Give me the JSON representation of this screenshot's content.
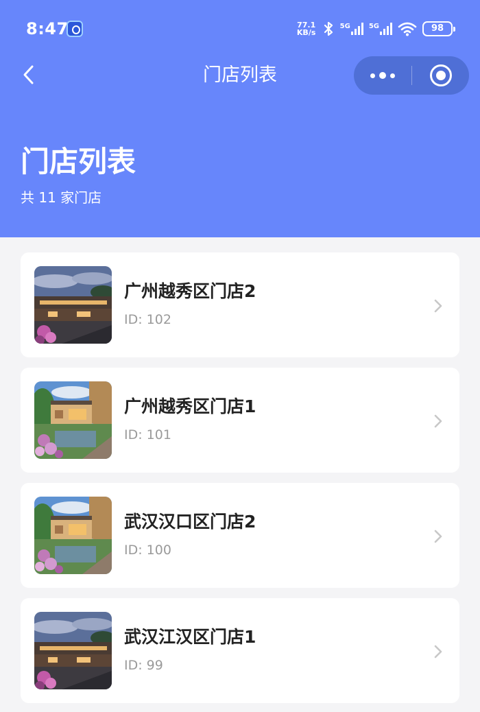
{
  "status_bar": {
    "time": "8:47",
    "net_speed_value": "77.1",
    "net_speed_unit": "KB/s",
    "signal_1_label": "5G",
    "signal_2_label": "5G",
    "battery": "98"
  },
  "nav": {
    "title": "门店列表"
  },
  "header": {
    "title": "门店列表",
    "subtitle": "共 11 家门店"
  },
  "stores": [
    {
      "name": "广州越秀区门店2",
      "id_text": "ID: 102",
      "image": "dusk-courtyard"
    },
    {
      "name": "广州越秀区门店1",
      "id_text": "ID: 101",
      "image": "garden-courtyard"
    },
    {
      "name": "武汉汉口区门店2",
      "id_text": "ID: 100",
      "image": "garden-courtyard"
    },
    {
      "name": "武汉江汉区门店1",
      "id_text": "ID: 99",
      "image": "dusk-courtyard"
    }
  ],
  "colors": {
    "header_bg": "#6786fb",
    "capsule_bg": "#4f6fd6",
    "page_bg": "#f4f4f6",
    "card_bg": "#ffffff",
    "name_text": "#222222",
    "id_text": "#9a9a9a"
  },
  "icons": {
    "back": "chevron-left-icon",
    "more": "more-dots-icon",
    "close": "target-circle-icon",
    "row_arrow": "chevron-right-icon"
  }
}
